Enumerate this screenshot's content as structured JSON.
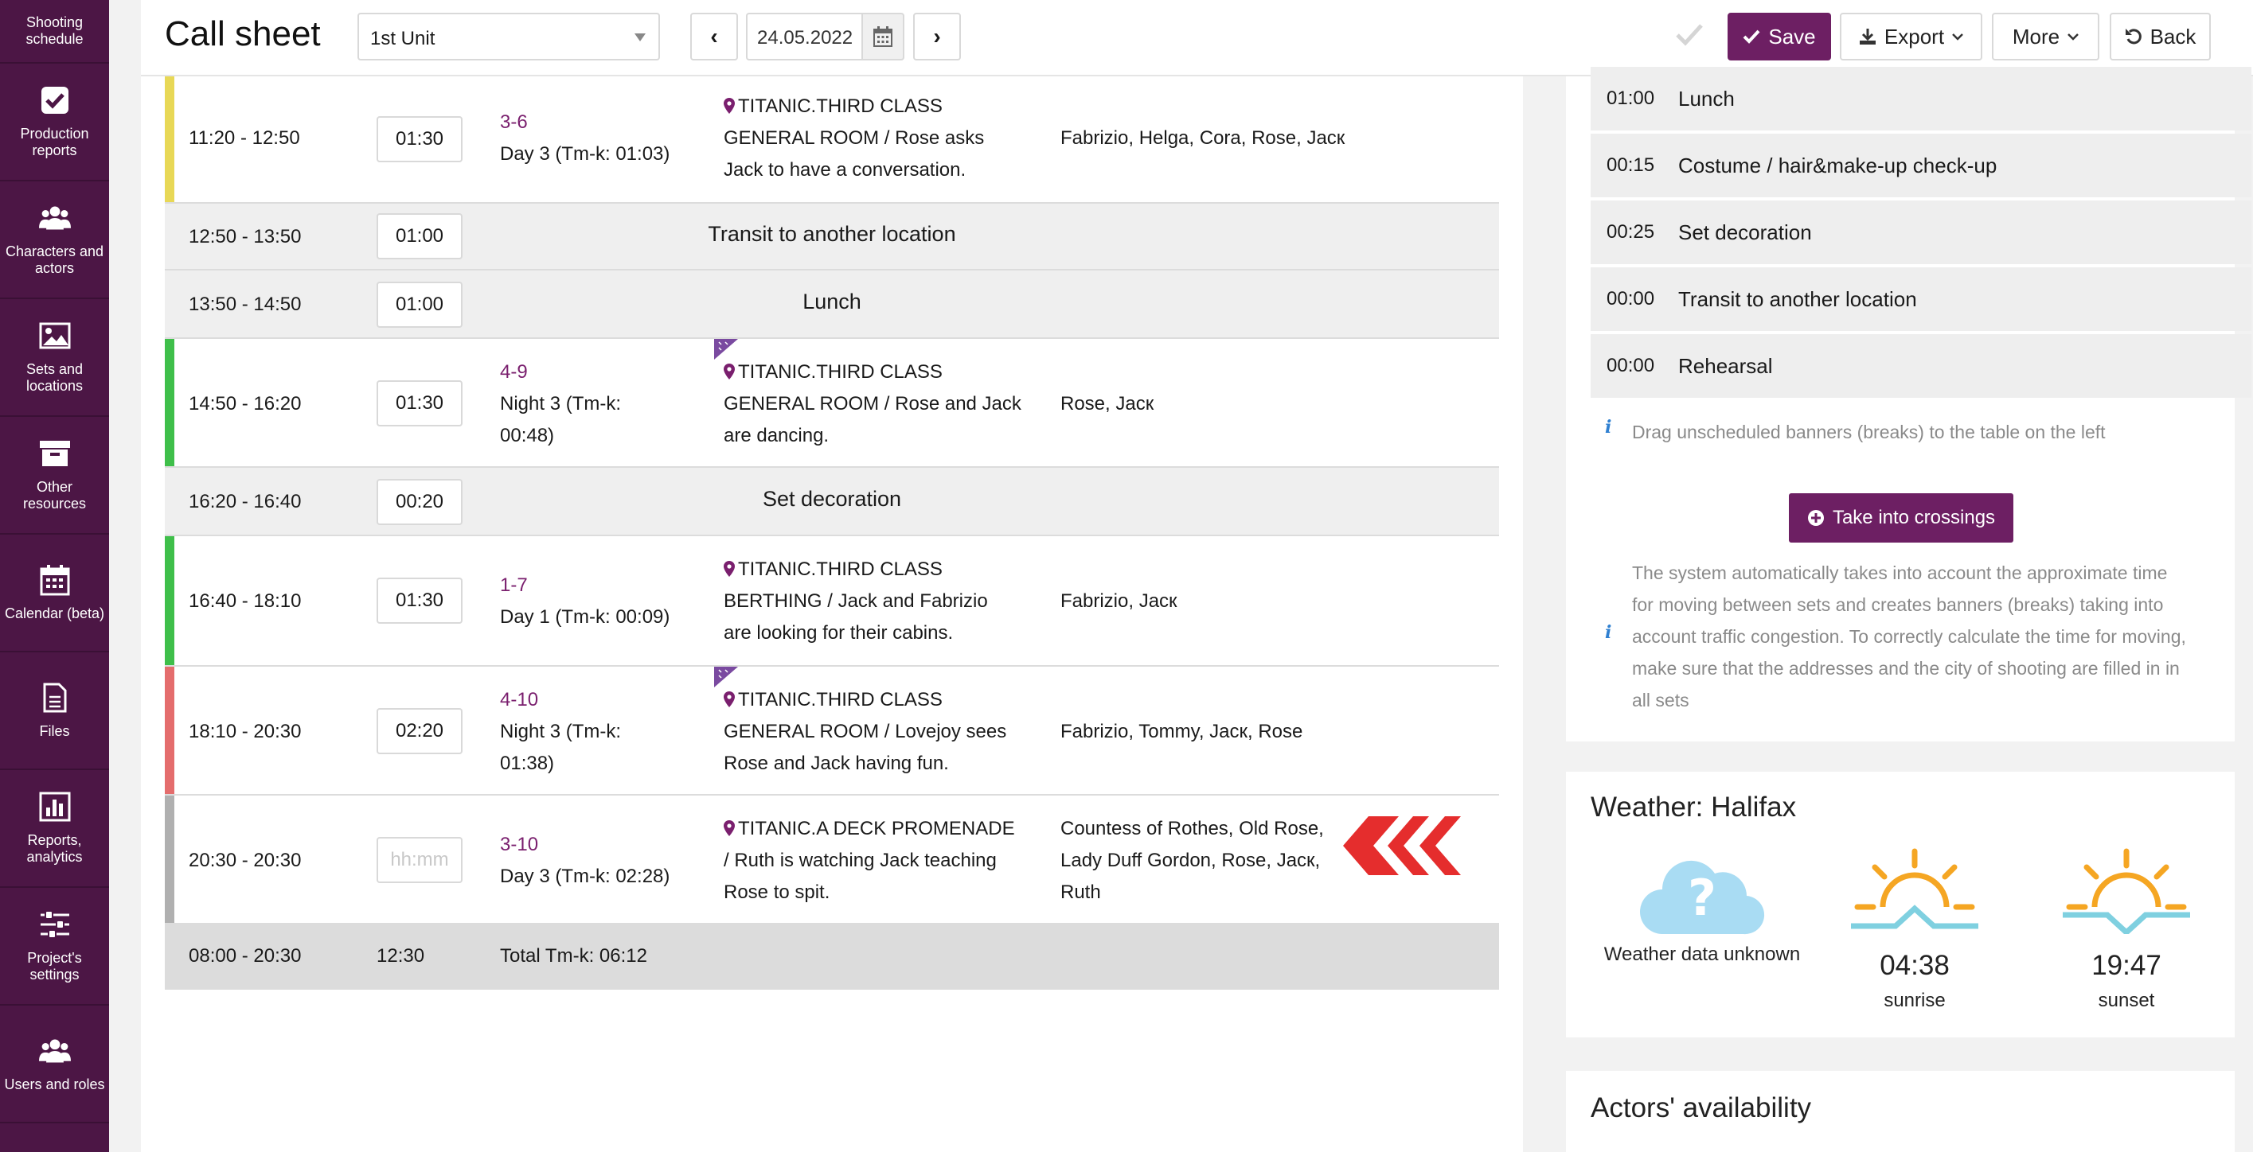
{
  "sidebar": {
    "items": [
      {
        "label": "Shooting schedule",
        "icon": "calendar-list-icon"
      },
      {
        "label": "Production reports",
        "icon": "checkbox-icon"
      },
      {
        "label": "Characters and actors",
        "icon": "users-icon"
      },
      {
        "label": "Sets and locations",
        "icon": "image-icon"
      },
      {
        "label": "Other resources",
        "icon": "archive-icon"
      },
      {
        "label": "Calendar (beta)",
        "icon": "calendar-icon"
      },
      {
        "label": "Files",
        "icon": "file-icon"
      },
      {
        "label": "Reports, analytics",
        "icon": "bar-chart-icon"
      },
      {
        "label": "Project's settings",
        "icon": "sliders-icon"
      },
      {
        "label": "Users and roles",
        "icon": "users-icon"
      }
    ]
  },
  "header": {
    "title": "Call sheet",
    "unit": "1st Unit",
    "prev_label": "‹",
    "next_label": "›",
    "date": "24.05.2022",
    "save_label": "Save",
    "export_label": "Export",
    "more_label": "More",
    "back_label": "Back"
  },
  "schedule": {
    "rows": [
      {
        "kind": "scene",
        "stripe": "#e8d856",
        "time": "11:20 - 12:50",
        "duration": "01:30",
        "scene": "3-6",
        "day": "Day 3 (Tm-k: 01:03)",
        "location_l1": "TITANIC.THIRD CLASS",
        "location_l2": "GENERAL ROOM / Rose asks",
        "location_l3": "Jack to have a conversation.",
        "cast": "Fabrizio, Helga, Cora, Rose, Jacк"
      },
      {
        "kind": "break",
        "time": "12:50 - 13:50",
        "duration": "01:00",
        "label": "Transit to another location"
      },
      {
        "kind": "break",
        "time": "13:50 - 14:50",
        "duration": "01:00",
        "label": "Lunch"
      },
      {
        "kind": "scene",
        "stripe": "#3fbf4a",
        "time": "14:50 - 16:20",
        "duration": "01:30",
        "scene": "4-9",
        "day_l1": "Night 3 (Tm-k:",
        "day_l2": "00:48)",
        "location_l1": "TITANIC.THIRD CLASS",
        "location_l2": "GENERAL ROOM / Rose and Jack",
        "location_l3": "are dancing.",
        "cast": "Rose, Jacк"
      },
      {
        "kind": "break",
        "time": "16:20 - 16:40",
        "duration": "00:20",
        "label": "Set decoration"
      },
      {
        "kind": "scene",
        "stripe": "#3fbf4a",
        "time": "16:40 - 18:10",
        "duration": "01:30",
        "scene": "1-7",
        "day": "Day 1 (Tm-k: 00:09)",
        "location_l1": "TITANIC.THIRD CLASS",
        "location_l2": "BERTHING / Jack and Fabrizio",
        "location_l3": "are looking for their cabins.",
        "cast": "Fabrizio, Jacк"
      },
      {
        "kind": "scene",
        "stripe": "#e46d6d",
        "time": "18:10 - 20:30",
        "duration": "02:20",
        "scene": "4-10",
        "day_l1": "Night 3 (Tm-k:",
        "day_l2": "01:38)",
        "location_l1": "TITANIC.THIRD CLASS",
        "location_l2": "GENERAL ROOM / Lovejoy sees",
        "location_l3": "Rose and Jack having fun.",
        "cast": "Fabrizio, Tommy, Jacк, Rose"
      },
      {
        "kind": "scene",
        "stripe": "#b0b0b0",
        "time": "20:30 - 20:30",
        "duration_placeholder": "hh:mm",
        "scene": "3-10",
        "day": "Day 3 (Tm-k: 02:28)",
        "location_l1": "TITANIC.A DECK PROMENADE",
        "location_l2": "/ Ruth is watching Jack teaching",
        "location_l3": "Rose to spit.",
        "cast_l1": "Countess of Rothes, Old Rose,",
        "cast_l2": "Lady Duff Gordon, Rose, Jacк,",
        "cast_l3": "Ruth"
      }
    ],
    "total": {
      "time": "08:00 - 20:30",
      "duration": "12:30",
      "label": "Total Tm-k: 06:12"
    }
  },
  "breaks_panel": {
    "items": [
      {
        "time": "01:00",
        "label": "Lunch"
      },
      {
        "time": "00:15",
        "label": "Costume / hair&make-up check-up"
      },
      {
        "time": "00:25",
        "label": "Set decoration"
      },
      {
        "time": "00:00",
        "label": "Transit to another location"
      },
      {
        "time": "00:00",
        "label": "Rehearsal"
      }
    ],
    "hint": "Drag unscheduled banners (breaks) to the table on the left",
    "take_label": "Take into crossings",
    "info_l1": "The system automatically takes into account the approximate time",
    "info_l2": "for moving between sets and creates banners (breaks) taking into",
    "info_l3": "account traffic congestion. To correctly calculate the time for moving,",
    "info_l4": "make sure that the addresses and the city of shooting are filled in in",
    "info_l5": "all sets"
  },
  "weather": {
    "title": "Weather: Halifax",
    "unknown": "Weather data unknown",
    "sunrise_time": "04:38",
    "sunrise_label": "sunrise",
    "sunset_time": "19:47",
    "sunset_label": "sunset"
  },
  "actors": {
    "title": "Actors' availability"
  },
  "colors": {
    "brand": "#6d1f63",
    "sidebar": "#4c1645",
    "sun": "#f5a623",
    "horizon": "#7fd0e0"
  }
}
